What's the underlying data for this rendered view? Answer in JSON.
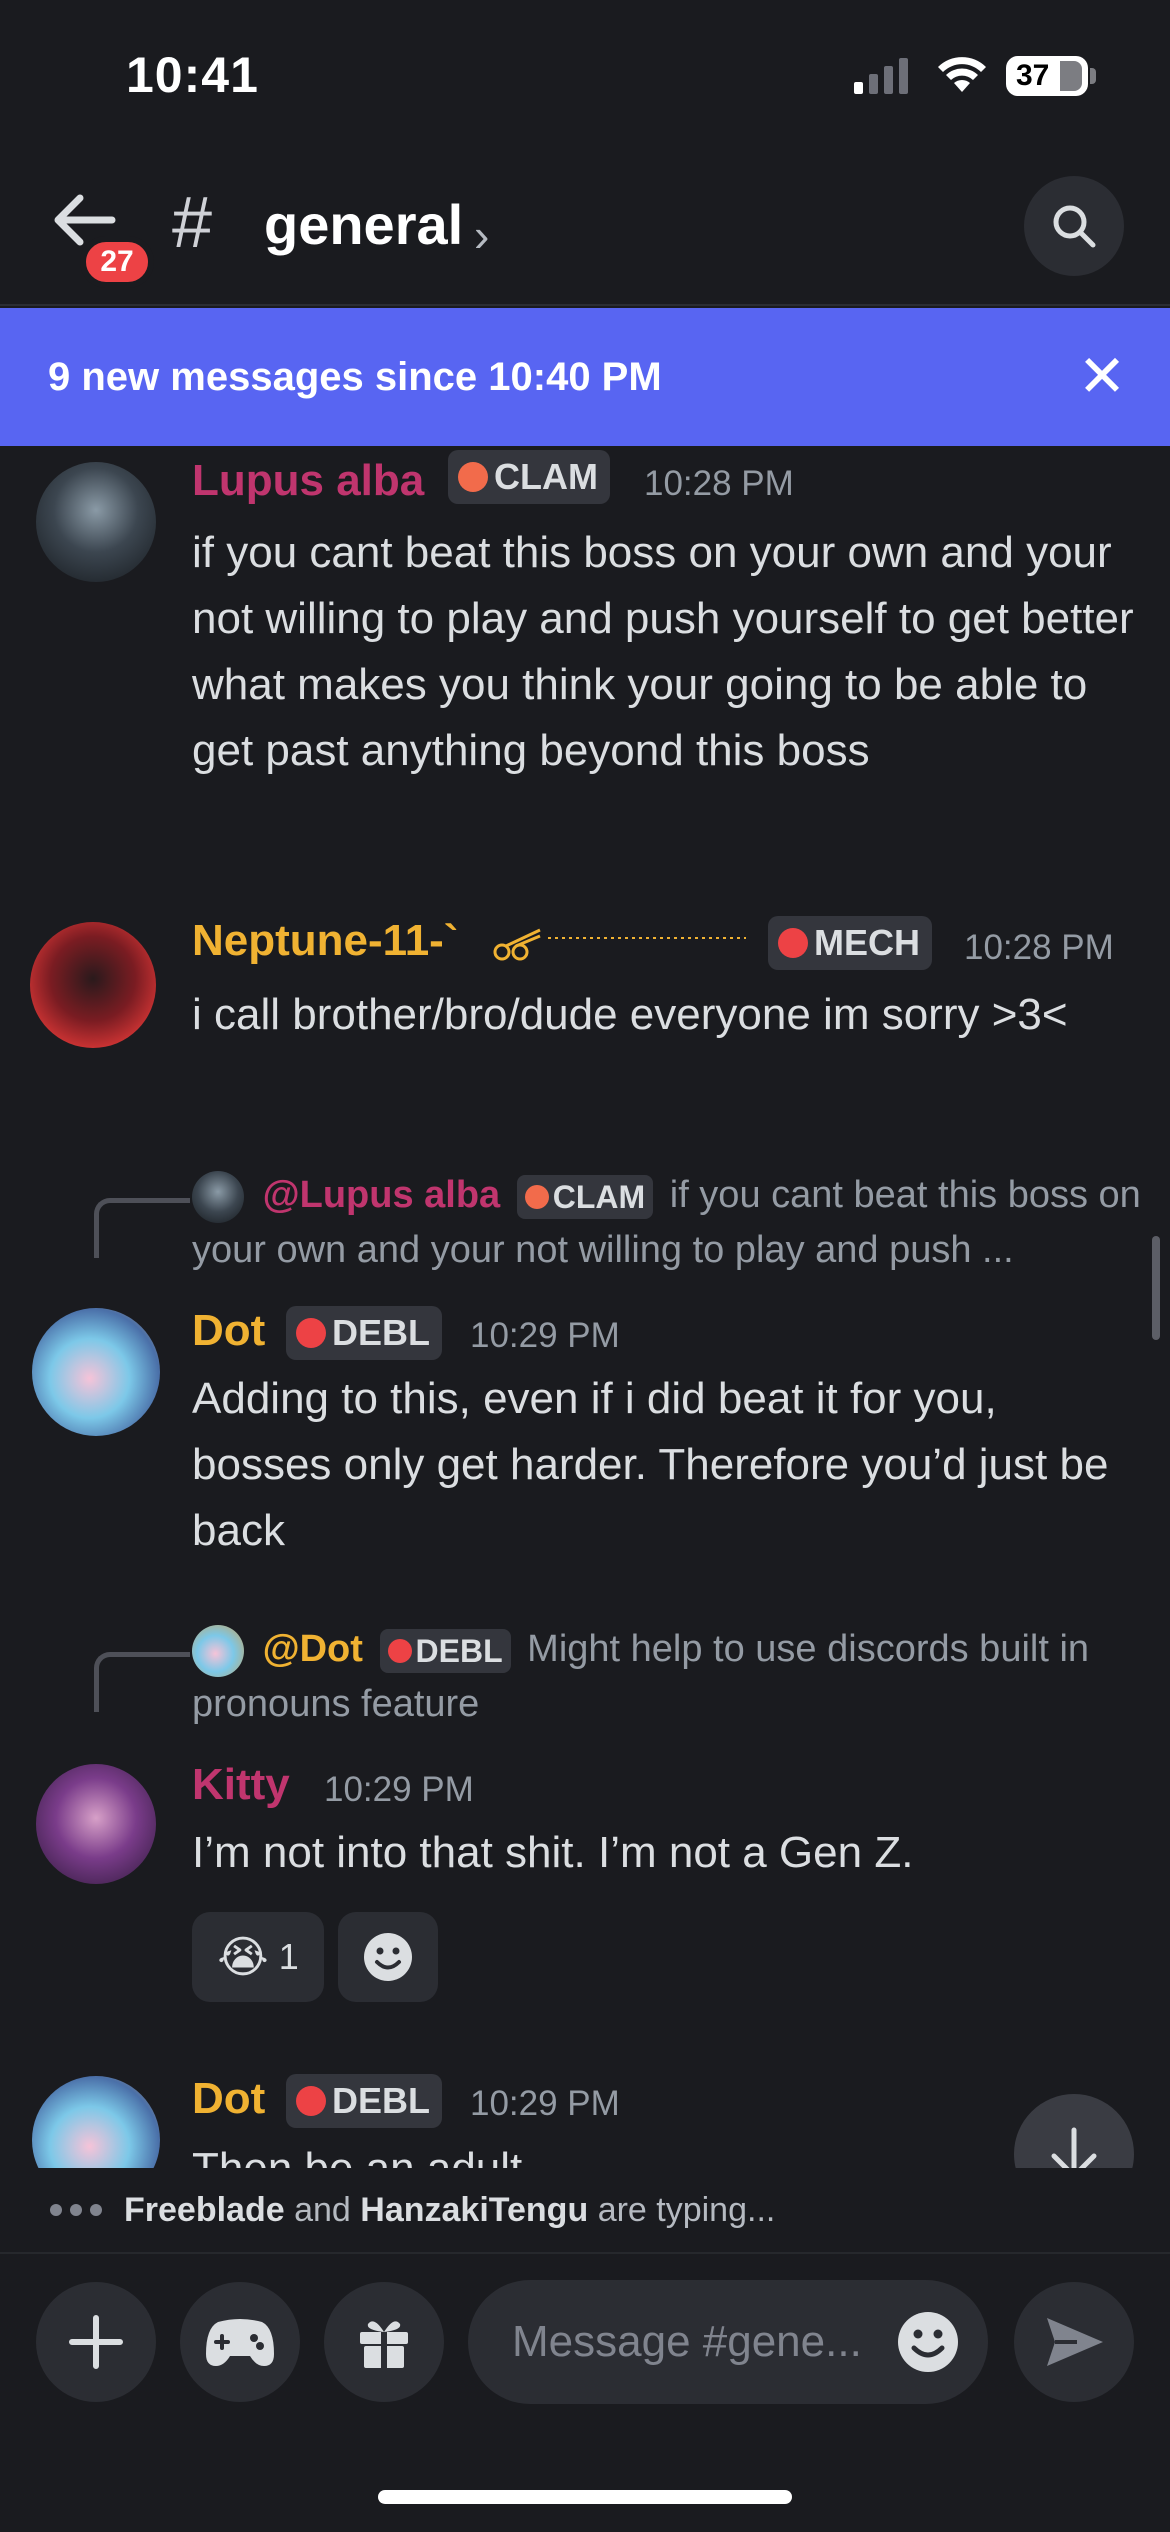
{
  "status_bar": {
    "time": "10:41",
    "battery": "37"
  },
  "header": {
    "unread_badge": "27",
    "hash": "#",
    "channel_name": "general",
    "chevron": "›"
  },
  "banner": {
    "text": "9 new messages since 10:40 PM",
    "close": "✕"
  },
  "messages": [
    {
      "author": "Lupus alba",
      "author_color": "#c0356e",
      "tag": "CLAM",
      "time": "10:28 PM",
      "text": "if you cant beat this boss on your own and your not willing to play and push yourself to get better what makes you think your going to be able to get past anything beyond this boss"
    },
    {
      "author": "Neptune-11-`",
      "author_color": "#f0b232",
      "tag": "MECH",
      "time": "10:28 PM",
      "text": "i call brother/bro/dude everyone im sorry >3<"
    },
    {
      "reply": {
        "name": "@Lupus alba",
        "tag": "CLAM",
        "text": "if you cant beat this boss on your own and your not willing to play and push ..."
      },
      "author": "Dot",
      "author_color": "#f0b232",
      "tag": "DEBL",
      "time": "10:29 PM",
      "text": "Adding to this, even if i did beat it for you, bosses only get harder. Therefore you’d just be back"
    },
    {
      "reply": {
        "name": "@Dot",
        "tag": "DEBL",
        "text": "Might help to use discords built in pronouns feature"
      },
      "author": "Kitty",
      "author_color": "#c0356e",
      "time": "10:29 PM",
      "text": "I’m not into that shit. I’m not a Gen Z.",
      "reactions": [
        {
          "emoji": "😭",
          "count": "1"
        }
      ]
    },
    {
      "author": "Dot",
      "author_color": "#f0b232",
      "tag": "DEBL",
      "time": "10:29 PM",
      "text": "Then be an adult"
    }
  ],
  "typing": {
    "user1": "Freeblade",
    "and": "and",
    "user2": "HanzakiTengu",
    "suffix": "are typing..."
  },
  "composer": {
    "placeholder": "Message #gene..."
  },
  "colors": {
    "accent": "#5865f2",
    "background": "#1a1b1f",
    "badge": "#ed4245"
  }
}
